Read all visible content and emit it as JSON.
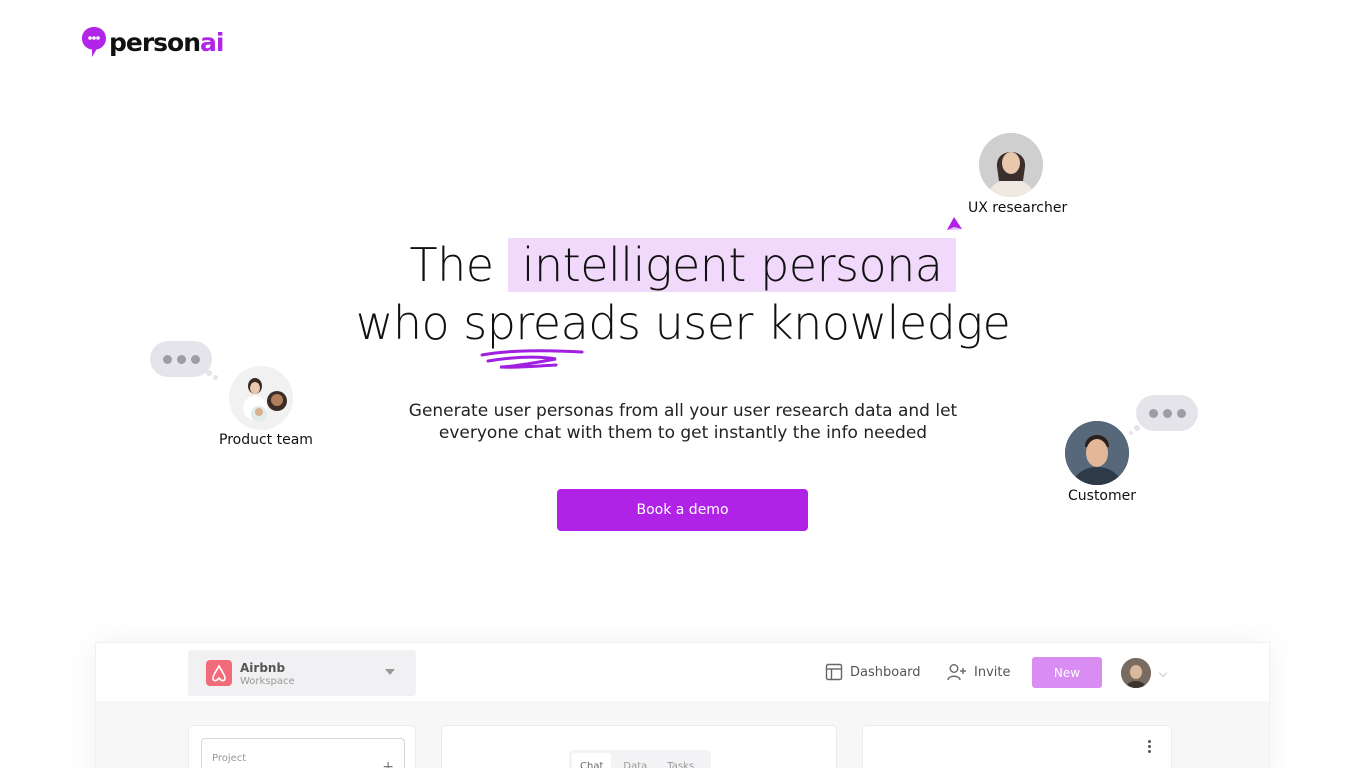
{
  "logo": {
    "text_main": "person",
    "text_accent": "ai"
  },
  "hero": {
    "headline_prefix": "The",
    "headline_highlight": "intelligent persona",
    "headline_line2": "who spreads user knowledge",
    "subtext_line1": "Generate user personas from all your user research data and let",
    "subtext_line2": "everyone chat with them to get instantly the info needed",
    "cta_label": "Book a demo"
  },
  "personas": {
    "ux_researcher": "UX researcher",
    "product_team": "Product team",
    "customer": "Customer"
  },
  "app_preview": {
    "workspace_name": "Airbnb",
    "workspace_sub": "Workspace",
    "nav_dashboard": "Dashboard",
    "nav_invite": "Invite",
    "new_label": "New",
    "project_placeholder": "Project",
    "tabs": [
      "Chat",
      "Data",
      "Tasks"
    ]
  },
  "colors": {
    "brand": "#b022e6",
    "highlight": "#f1d9fb",
    "new_button": "#d98cf2"
  }
}
